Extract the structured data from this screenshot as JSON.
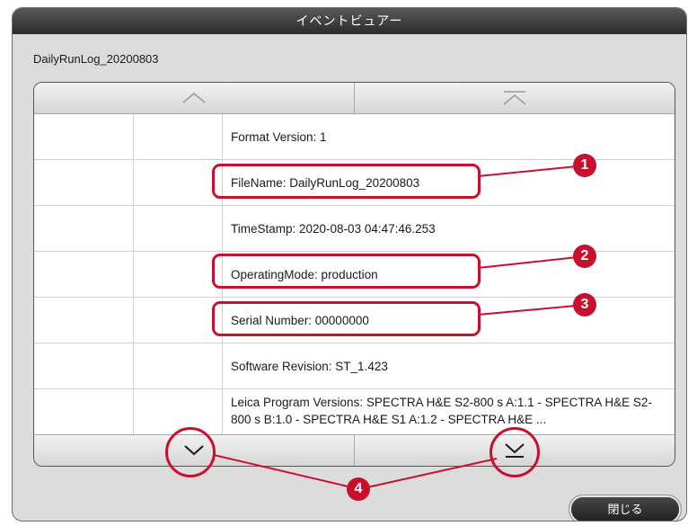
{
  "window": {
    "title": "イベントビュアー"
  },
  "file": {
    "name": "DailyRunLog_20200803"
  },
  "log_entries": [
    "Format Version: 1",
    "FileName: DailyRunLog_20200803",
    "TimeStamp: 2020-08-03 04:47:46.253",
    "OperatingMode: production",
    "Serial Number: 00000000",
    "Software Revision: ST_1.423",
    "Leica Program Versions: SPECTRA H&E S2-800 s A:1.1 - SPECTRA H&E S2-800 s B:1.0 - SPECTRA H&E S1 A:1.2 - SPECTRA H&E ..."
  ],
  "navigation": {
    "icons": [
      "chevron-up-icon",
      "skip-to-top-icon",
      "chevron-down-icon",
      "skip-to-bottom-icon"
    ]
  },
  "callouts": [
    "1",
    "2",
    "3",
    "4"
  ],
  "footer": {
    "close_label": "閉じる"
  },
  "colors": {
    "accent": "#c8102e",
    "titlebar": "#3a3a3a",
    "background": "#dcdcdc"
  }
}
